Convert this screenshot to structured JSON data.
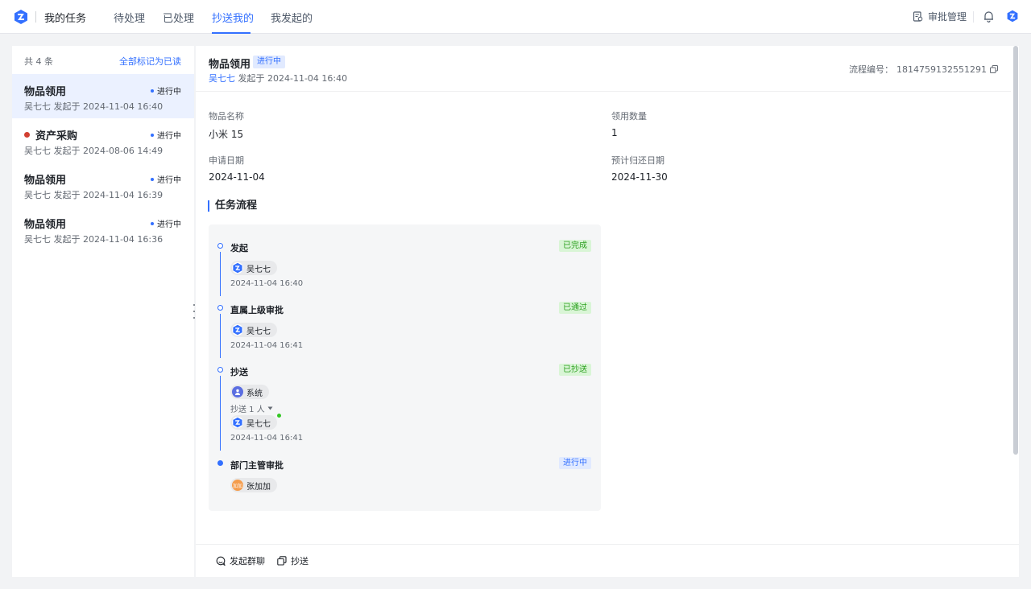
{
  "header": {
    "app_title": "我的任务",
    "tabs": [
      {
        "label": "待处理"
      },
      {
        "label": "已处理"
      },
      {
        "label": "抄送我的"
      },
      {
        "label": "我发起的"
      }
    ],
    "active_tab": "抄送我的",
    "approval_manage_label": "审批管理"
  },
  "list": {
    "count_label": "共 4 条",
    "mark_all_read_label": "全部标记为已读",
    "items": [
      {
        "title": "物品领用",
        "status": "进行中",
        "sub": "吴七七 发起于 2024-11-04 16:40",
        "selected": true,
        "unread": false
      },
      {
        "title": "资产采购",
        "status": "进行中",
        "sub": "吴七七 发起于 2024-08-06 14:49",
        "selected": false,
        "unread": true
      },
      {
        "title": "物品领用",
        "status": "进行中",
        "sub": "吴七七 发起于 2024-11-04 16:39",
        "selected": false,
        "unread": false
      },
      {
        "title": "物品领用",
        "status": "进行中",
        "sub": "吴七七 发起于 2024-11-04 16:36",
        "selected": false,
        "unread": false
      }
    ]
  },
  "detail": {
    "title": "物品领用",
    "status_badge": "进行中",
    "initiator_name": "吴七七",
    "initiated_text": "发起于 2024-11-04 16:40",
    "flow_no_label": "流程编号：",
    "flow_no": "1814759132551291",
    "fields": [
      {
        "label": "物品名称",
        "value": "小米 15"
      },
      {
        "label": "领用数量",
        "value": "1"
      },
      {
        "label": "申请日期",
        "value": "2024-11-04"
      },
      {
        "label": "预计归还日期",
        "value": "2024-11-30"
      }
    ],
    "section_title": "任务流程",
    "flow": {
      "nodes": [
        {
          "title": "发起",
          "tag": "已完成",
          "user": "吴七七",
          "time": "2024-11-04 16:40"
        },
        {
          "title": "直属上级审批",
          "tag": "已通过",
          "user": "吴七七",
          "time": "2024-11-04 16:41"
        },
        {
          "title": "抄送",
          "tag": "已抄送",
          "user": "系统",
          "cc_count": "抄送 1 人",
          "cc_user": "吴七七",
          "time": "2024-11-04 16:41"
        },
        {
          "title": "部门主管审批",
          "tag": "进行中",
          "user": "张加加",
          "avatar_text": "加加"
        }
      ]
    },
    "actions": {
      "group_chat_label": "发起群聊",
      "cc_label": "抄送"
    }
  },
  "colors": {
    "accent": "#3370ff",
    "done_green": "#2ea121",
    "unread_red": "#d23f31"
  }
}
